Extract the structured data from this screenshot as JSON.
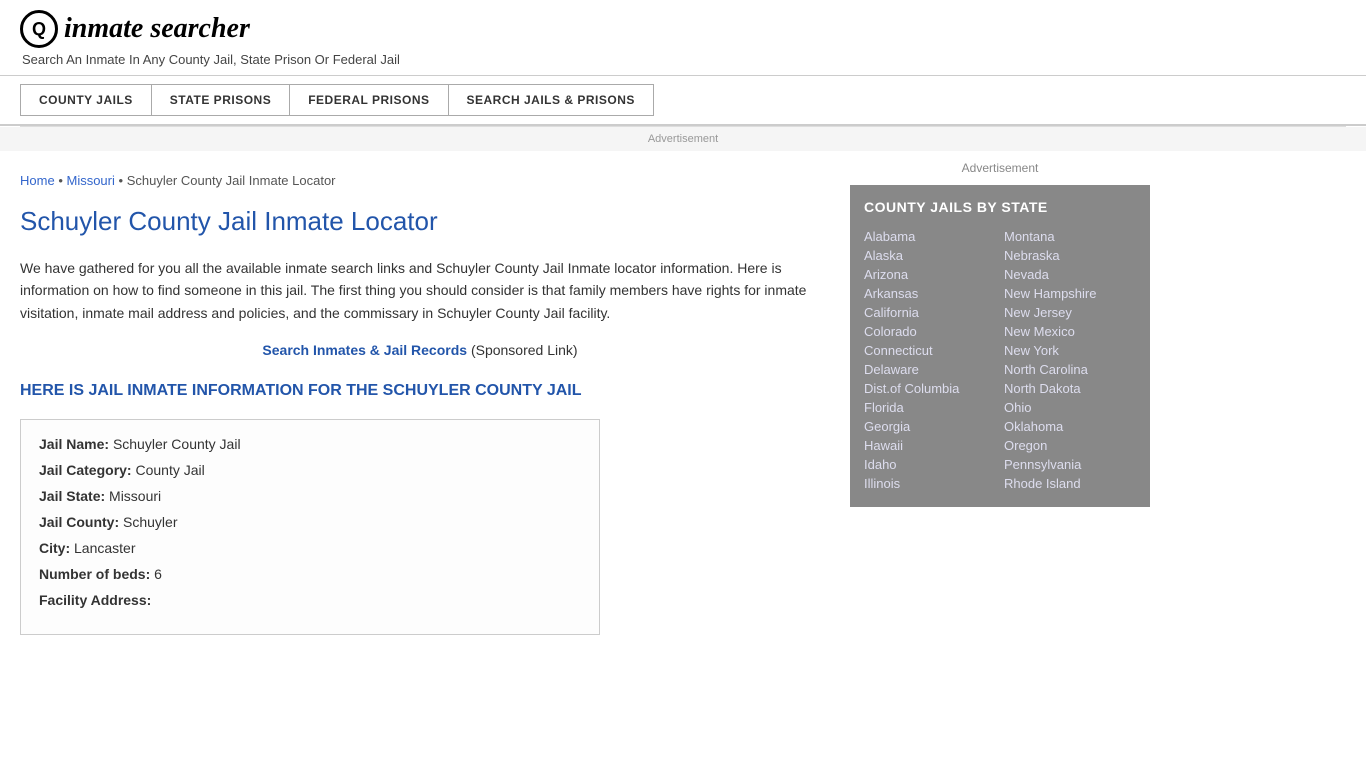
{
  "header": {
    "logo_icon": "Q",
    "logo_text": "inmate searcher",
    "tagline": "Search An Inmate In Any County Jail, State Prison Or Federal Jail"
  },
  "nav": {
    "items": [
      {
        "label": "COUNTY JAILS",
        "id": "county-jails"
      },
      {
        "label": "STATE PRISONS",
        "id": "state-prisons"
      },
      {
        "label": "FEDERAL PRISONS",
        "id": "federal-prisons"
      },
      {
        "label": "SEARCH JAILS & PRISONS",
        "id": "search-jails"
      }
    ]
  },
  "ad_label": "Advertisement",
  "breadcrumb": {
    "home": "Home",
    "state": "Missouri",
    "current": "Schuyler County Jail Inmate Locator"
  },
  "page_title": "Schuyler County Jail Inmate Locator",
  "description": "We have gathered for you all the available inmate search links and Schuyler County Jail Inmate locator information. Here is information on how to find someone in this jail. The first thing you should consider is that family members have rights for inmate visitation, inmate mail address and policies, and the commissary in Schuyler County Jail facility.",
  "sponsored": {
    "link_text": "Search Inmates & Jail Records",
    "suffix": "(Sponsored Link)"
  },
  "subheading": "HERE IS JAIL INMATE INFORMATION FOR THE SCHUYLER COUNTY JAIL",
  "jail_info": {
    "name_label": "Jail Name:",
    "name_value": "Schuyler County Jail",
    "category_label": "Jail Category:",
    "category_value": "County Jail",
    "state_label": "Jail State:",
    "state_value": "Missouri",
    "county_label": "Jail County:",
    "county_value": "Schuyler",
    "city_label": "City:",
    "city_value": "Lancaster",
    "beds_label": "Number of beds:",
    "beds_value": "6",
    "address_label": "Facility Address:"
  },
  "sidebar": {
    "ad_label": "Advertisement",
    "section_title": "COUNTY JAILS BY STATE",
    "states_left": [
      "Alabama",
      "Alaska",
      "Arizona",
      "Arkansas",
      "California",
      "Colorado",
      "Connecticut",
      "Delaware",
      "Dist.of Columbia",
      "Florida",
      "Georgia",
      "Hawaii",
      "Idaho",
      "Illinois"
    ],
    "states_right": [
      "Montana",
      "Nebraska",
      "Nevada",
      "New Hampshire",
      "New Jersey",
      "New Mexico",
      "New York",
      "North Carolina",
      "North Dakota",
      "Ohio",
      "Oklahoma",
      "Oregon",
      "Pennsylvania",
      "Rhode Island"
    ]
  }
}
